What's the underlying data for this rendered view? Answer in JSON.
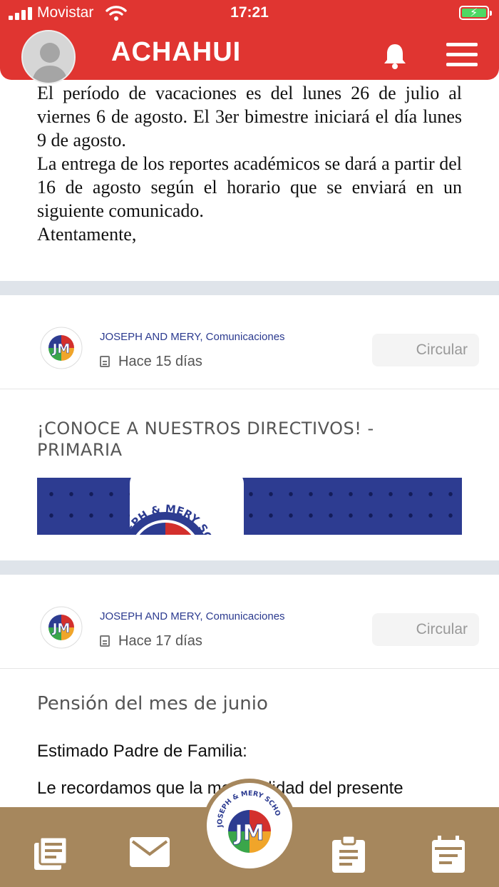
{
  "status_bar": {
    "carrier": "Movistar",
    "time": "17:21"
  },
  "header": {
    "title": "ACHAHUI",
    "avatar_icon": "user-avatar-icon",
    "bell_icon": "bell-icon",
    "menu_icon": "hamburger-menu-icon",
    "accent_color": "#e03531"
  },
  "feed": {
    "post1": {
      "body_lines": [
        "El período de vacaciones es del lunes 26 de julio al viernes 6 de agosto. El 3er bimestre iniciará el día lunes 9 de agosto.",
        "La entrega de los reportes académicos se dará a partir del 16 de agosto según el horario que se enviará en un siguiente comunicado.",
        "Atentamente,"
      ]
    },
    "post2": {
      "source": "JOSEPH AND MERY, Comunicaciones",
      "date": "Hace 15 días",
      "tag": "Circular",
      "title": "¡CONOCE A NUESTROS DIRECTIVOS! - PRIMARIA",
      "banner_logo_text": "JOSEPH & MERY SCHOOL"
    },
    "post3": {
      "source": "JOSEPH AND MERY, Comunicaciones",
      "date": "Hace 17 días",
      "tag": "Circular",
      "title": "Pensión del mes de junio",
      "greeting": "Estimado Padre de Familia:",
      "text_partial": "Le recordamos que la mensualidad del presente"
    }
  },
  "bottom_nav": {
    "background_color": "#a6875d",
    "items": [
      "news-icon",
      "mail-icon",
      "school-logo-button",
      "clipboard-icon",
      "calendar-icon"
    ],
    "center_logo_text": "JOSEPH & MERY SCHOOL"
  }
}
